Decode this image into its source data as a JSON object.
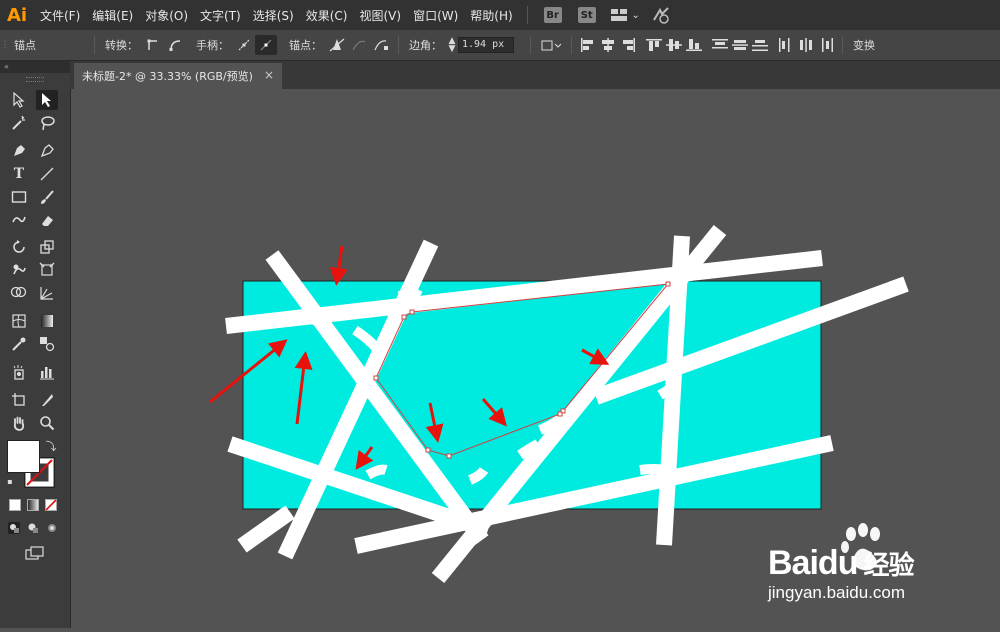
{
  "app": {
    "logo": "Ai"
  },
  "menu": [
    "文件(F)",
    "编辑(E)",
    "对象(O)",
    "文字(T)",
    "选择(S)",
    "效果(C)",
    "视图(V)",
    "窗口(W)",
    "帮助(H)"
  ],
  "app_buttons": [
    "Br",
    "St"
  ],
  "control_bar": {
    "selection_label": "锚点",
    "convert_label": "转换：",
    "handles_label": "手柄：",
    "anchor_label": "锚点：",
    "corner_label": "边角：",
    "corner_value": "1.94 px",
    "transform_label": "变换"
  },
  "document_tab": {
    "title": "未标题-2* @ 33.33% (RGB/预览)",
    "close": "×"
  },
  "watermark": {
    "brand_bai": "Bai",
    "brand_du": "du",
    "brand_cn": "经验",
    "url": "jingyan.baidu.com"
  },
  "colors": {
    "cyan_fill": "#00ebe0",
    "arrow": "#e8120c",
    "canvas_bg": "#535353",
    "path_outline": "#d04040"
  }
}
